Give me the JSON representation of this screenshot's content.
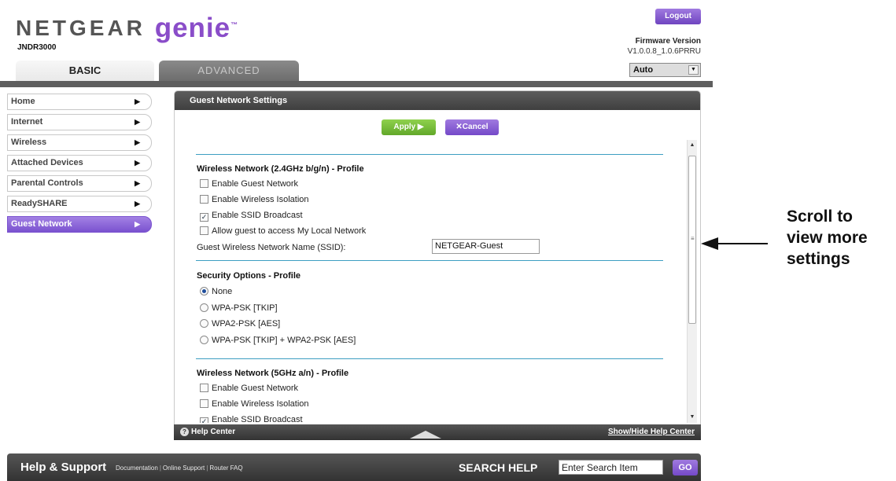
{
  "header": {
    "brand": "NETGEAR",
    "brand_suffix": "genie",
    "trademark": "™",
    "model": "JNDR3000",
    "logout_label": "Logout",
    "firmware_label": "Firmware Version",
    "firmware_version": "V1.0.0.8_1.0.6PRRU",
    "language_selected": "Auto"
  },
  "tabs": [
    {
      "label": "BASIC",
      "active": true
    },
    {
      "label": "ADVANCED",
      "active": false
    }
  ],
  "sidebar": {
    "items": [
      {
        "label": "Home"
      },
      {
        "label": "Internet"
      },
      {
        "label": "Wireless"
      },
      {
        "label": "Attached Devices"
      },
      {
        "label": "Parental Controls"
      },
      {
        "label": "ReadySHARE"
      },
      {
        "label": "Guest Network",
        "active": true
      }
    ]
  },
  "panel": {
    "title": "Guest Network Settings",
    "apply_label": "Apply ▶",
    "cancel_label": "Cancel",
    "cancel_icon": "✕",
    "section_24": {
      "title": "Wireless Network (2.4GHz b/g/n) - Profile",
      "enable_guest": {
        "label": "Enable Guest Network",
        "checked": false
      },
      "enable_isolation": {
        "label": "Enable Wireless Isolation",
        "checked": false
      },
      "enable_ssid_broadcast": {
        "label": "Enable SSID Broadcast",
        "checked": true
      },
      "allow_local": {
        "label": "Allow guest to access My Local Network",
        "checked": false
      },
      "ssid_label": "Guest Wireless Network Name (SSID):",
      "ssid_value": "NETGEAR-Guest"
    },
    "security": {
      "title": "Security Options - Profile",
      "options": [
        {
          "label": "None",
          "selected": true
        },
        {
          "label": "WPA-PSK [TKIP]",
          "selected": false
        },
        {
          "label": "WPA2-PSK [AES]",
          "selected": false
        },
        {
          "label": "WPA-PSK [TKIP] + WPA2-PSK [AES]",
          "selected": false
        }
      ]
    },
    "section_5": {
      "title": "Wireless Network (5GHz a/n) - Profile",
      "enable_guest": {
        "label": "Enable Guest Network",
        "checked": false
      },
      "enable_isolation": {
        "label": "Enable Wireless Isolation",
        "checked": false
      },
      "enable_ssid_broadcast": {
        "label": "Enable SSID Broadcast",
        "checked": true
      }
    }
  },
  "helpbar": {
    "help_center": "Help Center",
    "show_hide": "Show/Hide Help Center"
  },
  "footer": {
    "help_support": "Help & Support",
    "links": [
      "Documentation",
      "Online Support",
      "Router FAQ"
    ],
    "search_help": "SEARCH HELP",
    "search_value": "Enter Search Item",
    "go_label": "GO"
  },
  "callout": {
    "line1": "Scroll to",
    "line2": "view more",
    "line3": "settings"
  },
  "colors": {
    "accent_purple": "#7a52cf",
    "apply_green": "#62a82a",
    "divider_blue": "#3d9ec2",
    "dark_bar": "#5e5e5e"
  }
}
